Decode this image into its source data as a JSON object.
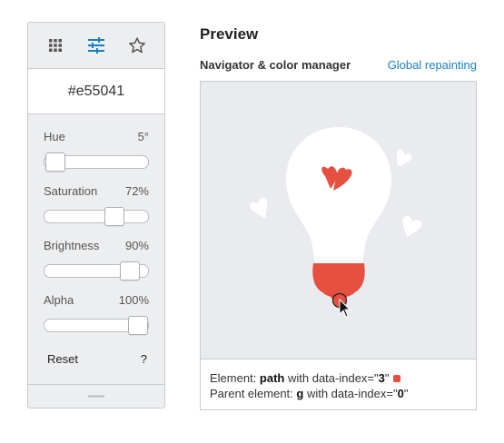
{
  "toolbar": {
    "icons": [
      "grid-icon",
      "sliders-icon",
      "star-icon"
    ],
    "active": "sliders-icon",
    "active_color": "#1a7fc1"
  },
  "color": {
    "hex": "#e55041"
  },
  "controls": [
    {
      "label": "Hue",
      "value": "5°",
      "fraction": 0.014
    },
    {
      "label": "Saturation",
      "value": "72%",
      "fraction": 0.72
    },
    {
      "label": "Brightness",
      "value": "90%",
      "fraction": 0.9
    },
    {
      "label": "Alpha",
      "value": "100%",
      "fraction": 1.0
    }
  ],
  "reset_label": "Reset",
  "help_label": "?",
  "preview": {
    "title": "Preview",
    "navigator_label": "Navigator & color manager",
    "global_link": "Global repainting"
  },
  "info": {
    "line1_prefix": "Element: ",
    "line1_element": "path",
    "line1_mid": " with data-index=\"",
    "line1_index": "3",
    "line1_suffix": "\"",
    "line2_prefix": "Parent element: ",
    "line2_element": "g",
    "line2_mid": " with data-index=\"",
    "line2_index": "0",
    "line2_suffix": "\"",
    "swatch_color": "#e55041"
  }
}
